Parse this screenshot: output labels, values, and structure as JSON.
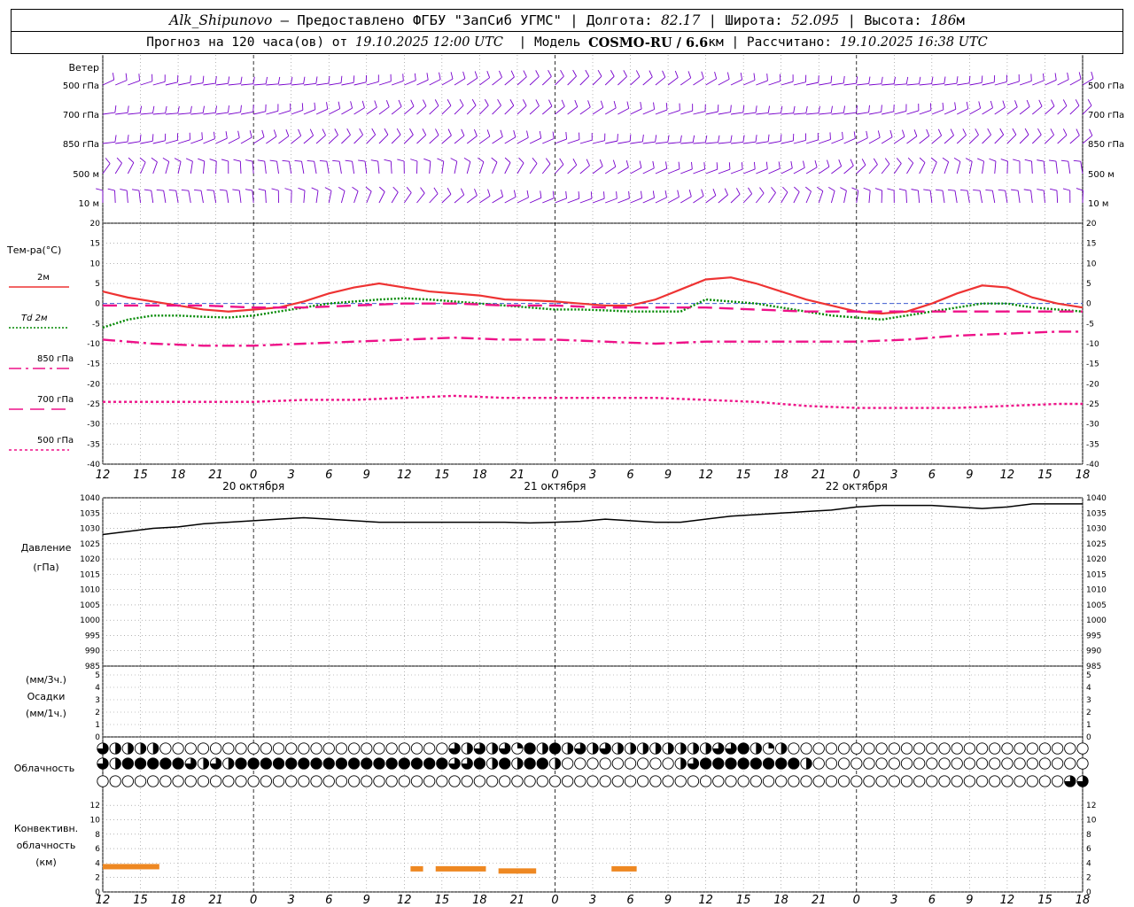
{
  "header": {
    "station": "Alk_Shipunovo",
    "provider": "Предоставлено ФГБУ \"ЗапСиб УГМС\"",
    "lon_label": "Долгота:",
    "lon": "82.17",
    "lat_label": "Широта:",
    "lat": "52.095",
    "alt_label": "Высота:",
    "alt": "186",
    "alt_unit": "м",
    "forecast_prefix": "Прогноз на 120 часа(ов) от",
    "forecast_start": "19.10.2025 12:00 UTC",
    "model_label": "Модель",
    "model": "COSMO-RU / 6.6",
    "model_unit": "км",
    "computed_label": "Рассчитано:",
    "computed": "19.10.2025 16:38 UTC"
  },
  "colors": {
    "wind": "#7700cc",
    "t2m": "#ee3333",
    "td2m": "#008800",
    "t850": "#ee1188",
    "t700": "#ee1188",
    "t500": "#ee1188",
    "pressure": "#000000",
    "convective": "#ee8822",
    "zero_line": "#2244cc",
    "grid": "#888888"
  },
  "chart_data": [
    {
      "type": "wind_barbs",
      "panel_label": "Ветер",
      "levels": [
        "500 гПа",
        "700 гПа",
        "850 гПа",
        "500 м",
        "10 м"
      ]
    },
    {
      "type": "line",
      "panel_label": "Тем-ра(°C)",
      "ylim": [
        -40,
        20
      ],
      "yticks": [
        -40,
        -35,
        -30,
        -25,
        -20,
        -15,
        -10,
        -5,
        0,
        5,
        10,
        15,
        20
      ],
      "xlim": [
        0,
        78
      ],
      "xticks": [
        "12",
        "15",
        "18",
        "21",
        "0",
        "3",
        "6",
        "9",
        "12",
        "15",
        "18",
        "21",
        "0",
        "3",
        "6",
        "9",
        "12",
        "15",
        "18",
        "21",
        "0",
        "3",
        "6",
        "9",
        "12",
        "15",
        "18"
      ],
      "day_labels": [
        "20 октября",
        "21 октября",
        "22 октября"
      ],
      "series": [
        {
          "name": "2м",
          "style": "solid",
          "color_key": "t2m",
          "x": [
            0,
            2,
            4,
            6,
            8,
            10,
            12,
            14,
            16,
            18,
            20,
            22,
            24,
            26,
            28,
            30,
            32,
            34,
            36,
            38,
            40,
            42,
            44,
            46,
            48,
            50,
            52,
            54,
            56,
            58,
            60,
            62,
            64,
            66,
            68,
            70,
            72,
            74,
            76,
            78
          ],
          "y": [
            3,
            1.5,
            0.5,
            -0.5,
            -1.5,
            -2,
            -1.5,
            -1,
            0.5,
            2.5,
            4,
            5,
            4,
            3,
            2.5,
            2,
            1,
            0.8,
            0.5,
            0,
            -0.5,
            -0.5,
            1,
            3.5,
            6,
            6.5,
            5,
            3,
            1,
            -0.5,
            -2,
            -2.5,
            -2,
            0,
            2.5,
            4.5,
            4,
            1.5,
            0,
            -1
          ]
        },
        {
          "name": "Td 2м",
          "style": "dotted",
          "color_key": "td2m",
          "x": [
            0,
            2,
            4,
            6,
            8,
            10,
            12,
            14,
            16,
            18,
            20,
            22,
            24,
            26,
            28,
            30,
            32,
            34,
            36,
            38,
            40,
            42,
            44,
            46,
            48,
            50,
            52,
            54,
            56,
            58,
            60,
            62,
            64,
            66,
            68,
            70,
            72,
            74,
            76,
            78
          ],
          "y": [
            -6,
            -4,
            -3,
            -3,
            -3.3,
            -3.5,
            -3,
            -2,
            -1,
            0,
            0.5,
            1,
            1.3,
            1,
            0.5,
            0,
            -0.5,
            -1,
            -1.5,
            -1.5,
            -1.7,
            -2,
            -2,
            -2,
            1,
            0.5,
            0,
            -1,
            -2,
            -3,
            -3.5,
            -4,
            -3,
            -2,
            -1,
            0,
            0,
            -1,
            -1.5,
            -2
          ]
        },
        {
          "name": "850 гПа",
          "style": "dashdot",
          "color_key": "t850",
          "x": [
            0,
            4,
            8,
            12,
            16,
            20,
            24,
            28,
            32,
            36,
            40,
            44,
            48,
            52,
            56,
            60,
            64,
            68,
            72,
            76,
            78
          ],
          "y": [
            -9,
            -10,
            -10.5,
            -10.5,
            -10,
            -9.5,
            -9,
            -8.5,
            -9,
            -9,
            -9.5,
            -10,
            -9.5,
            -9.5,
            -9.5,
            -9.5,
            -9,
            -8,
            -7.5,
            -7,
            -7
          ]
        },
        {
          "name": "700 гПа",
          "style": "longdash",
          "color_key": "t700",
          "x": [
            0,
            4,
            8,
            12,
            16,
            20,
            24,
            28,
            32,
            36,
            40,
            44,
            48,
            52,
            56,
            60,
            64,
            68,
            72,
            76,
            78
          ],
          "y": [
            -0.5,
            -0.5,
            -0.5,
            -1,
            -1,
            -0.5,
            0,
            0,
            -0.5,
            -0.5,
            -1,
            -1,
            -1,
            -1.5,
            -2,
            -2,
            -2,
            -2,
            -2,
            -2,
            -2
          ]
        },
        {
          "name": "500 гПа",
          "style": "dashed",
          "color_key": "t500",
          "x": [
            0,
            4,
            8,
            12,
            16,
            20,
            24,
            28,
            32,
            36,
            40,
            44,
            48,
            52,
            56,
            60,
            64,
            68,
            72,
            76,
            78
          ],
          "y": [
            -24.5,
            -24.5,
            -24.5,
            -24.5,
            -24,
            -24,
            -23.5,
            -23,
            -23.5,
            -23.5,
            -23.5,
            -23.5,
            -24,
            -24.5,
            -25.5,
            -26,
            -26,
            -26,
            -25.5,
            -25,
            -25
          ]
        }
      ]
    },
    {
      "type": "line",
      "panel_label": "Давление",
      "unit_label": "(гПа)",
      "ylim": [
        985,
        1040
      ],
      "yticks": [
        985,
        990,
        995,
        1000,
        1005,
        1010,
        1015,
        1020,
        1025,
        1030,
        1035,
        1040
      ],
      "series": [
        {
          "x": [
            0,
            2,
            4,
            6,
            8,
            10,
            12,
            14,
            16,
            18,
            20,
            22,
            24,
            26,
            28,
            30,
            32,
            34,
            36,
            38,
            40,
            42,
            44,
            46,
            48,
            50,
            52,
            54,
            56,
            58,
            60,
            62,
            64,
            66,
            68,
            70,
            72,
            74,
            76,
            78
          ],
          "y": [
            1028,
            1029,
            1030,
            1030.5,
            1031.5,
            1032,
            1032.5,
            1033,
            1033.5,
            1033,
            1032.5,
            1032,
            1032,
            1032,
            1032,
            1032,
            1032,
            1031.8,
            1032,
            1032.3,
            1033,
            1032.5,
            1032,
            1032,
            1033,
            1034,
            1034.5,
            1035,
            1035.5,
            1036,
            1037,
            1037.5,
            1037.5,
            1037.5,
            1037,
            1036.5,
            1037,
            1038,
            1038,
            1038
          ]
        }
      ]
    },
    {
      "type": "bar",
      "panel_label": "Осадки",
      "unit_labels": [
        "(мм/3ч.)",
        "(мм/1ч.)"
      ],
      "ylim": [
        0,
        5
      ],
      "yticks": [
        0,
        1,
        2,
        3,
        4,
        5
      ],
      "values": []
    },
    {
      "type": "cloud_symbols",
      "panel_label": "Облачность",
      "rows": [
        {
          "level": "upper",
          "x": [
            0,
            1,
            2,
            3,
            4,
            5,
            6,
            7,
            8,
            9,
            10,
            11,
            12,
            13,
            14,
            15,
            16,
            17,
            18,
            19,
            20,
            21,
            22,
            23,
            24,
            25,
            26,
            27,
            28,
            29,
            30,
            31,
            32,
            33,
            34,
            35,
            36,
            37,
            38,
            39,
            40,
            41,
            42,
            43,
            44,
            45,
            46,
            47,
            48,
            49,
            50,
            51,
            52,
            53,
            54,
            55,
            56,
            57,
            58,
            59,
            60,
            61,
            62,
            63,
            64,
            65,
            66,
            67,
            68,
            69,
            70,
            71,
            72,
            73,
            74,
            75,
            76,
            77,
            78
          ],
          "cover": [
            0.75,
            0.5,
            0.5,
            0.5,
            0.5,
            0,
            0,
            0,
            0,
            0,
            0,
            0,
            0,
            0,
            0,
            0,
            0,
            0,
            0,
            0,
            0,
            0,
            0,
            0,
            0,
            0,
            0,
            0,
            0.75,
            0.5,
            0.75,
            0.5,
            0.75,
            0.25,
            1,
            0.5,
            1,
            0.5,
            0.75,
            0.5,
            0.75,
            0.5,
            0.5,
            0.5,
            0.5,
            0.5,
            0.5,
            0.5,
            0.5,
            0.75,
            0.75,
            1,
            0.5,
            0.25,
            0.5,
            0,
            0,
            0,
            0,
            0,
            0,
            0,
            0,
            0,
            0,
            0,
            0,
            0,
            0,
            0,
            0,
            0,
            0,
            0,
            0,
            0,
            0,
            0,
            0
          ]
        },
        {
          "level": "middle",
          "x": [
            0,
            1,
            2,
            3,
            4,
            5,
            6,
            7,
            8,
            9,
            10,
            11,
            12,
            13,
            14,
            15,
            16,
            17,
            18,
            19,
            20,
            21,
            22,
            23,
            24,
            25,
            26,
            27,
            28,
            29,
            30,
            31,
            32,
            33,
            34,
            35,
            36,
            37,
            38,
            39,
            40,
            41,
            42,
            43,
            44,
            45,
            46,
            47,
            48,
            49,
            50,
            51,
            52,
            53,
            54,
            55,
            56,
            57,
            58,
            59,
            60,
            61,
            62,
            63,
            64,
            65,
            66,
            67,
            68,
            69,
            70,
            71,
            72,
            73,
            74,
            75,
            76,
            77,
            78
          ],
          "cover": [
            0.75,
            0.5,
            1,
            1,
            1,
            1,
            1,
            0.75,
            0.5,
            0.75,
            0.5,
            1,
            1,
            1,
            1,
            1,
            1,
            1,
            1,
            1,
            1,
            1,
            1,
            1,
            1,
            1,
            1,
            1,
            0.75,
            0.75,
            1,
            0.5,
            1,
            0.5,
            1,
            1,
            0.5,
            0,
            0,
            0,
            0,
            0,
            0,
            0,
            0,
            0,
            0.5,
            0.75,
            1,
            1,
            1,
            1,
            1,
            1,
            1,
            1,
            0.5,
            0,
            0,
            0,
            0,
            0,
            0,
            0,
            0,
            0,
            0,
            0,
            0,
            0,
            0,
            0,
            0,
            0,
            0,
            0,
            0,
            0,
            0
          ]
        },
        {
          "level": "lower",
          "x": [
            0,
            1,
            2,
            3,
            4,
            5,
            6,
            7,
            8,
            9,
            10,
            11,
            12,
            13,
            14,
            15,
            16,
            17,
            18,
            19,
            20,
            21,
            22,
            23,
            24,
            25,
            26,
            27,
            28,
            29,
            30,
            31,
            32,
            33,
            34,
            35,
            36,
            37,
            38,
            39,
            40,
            41,
            42,
            43,
            44,
            45,
            46,
            47,
            48,
            49,
            50,
            51,
            52,
            53,
            54,
            55,
            56,
            57,
            58,
            59,
            60,
            61,
            62,
            63,
            64,
            65,
            66,
            67,
            68,
            69,
            70,
            71,
            72,
            73,
            74,
            75,
            76,
            77,
            78
          ],
          "cover": [
            0,
            0,
            0,
            0,
            0,
            0,
            0,
            0,
            0,
            0,
            0,
            0,
            0,
            0,
            0,
            0,
            0,
            0,
            0,
            0,
            0,
            0,
            0,
            0,
            0,
            0,
            0,
            0,
            0,
            0,
            0,
            0,
            0,
            0,
            0,
            0,
            0,
            0,
            0,
            0,
            0,
            0,
            0,
            0,
            0,
            0,
            0,
            0,
            0,
            0,
            0,
            0,
            0,
            0,
            0,
            0,
            0,
            0,
            0,
            0,
            0,
            0,
            0,
            0,
            0,
            0,
            0,
            0,
            0,
            0,
            0,
            0,
            0,
            0,
            0,
            0,
            0,
            0.75,
            0.75
          ]
        }
      ]
    },
    {
      "type": "bar",
      "panel_label_lines": [
        "Конвективн.",
        "облачность",
        "(км)"
      ],
      "ylim": [
        0,
        13
      ],
      "yticks": [
        0,
        2,
        4,
        6,
        8,
        10,
        12
      ],
      "segments": [
        {
          "x0": 0,
          "x1": 4.5,
          "base": 3.5
        },
        {
          "x0": 24.5,
          "x1": 25.5,
          "base": 3.2
        },
        {
          "x0": 26.5,
          "x1": 30.5,
          "base": 3.2
        },
        {
          "x0": 31.5,
          "x1": 34.5,
          "base": 2.9
        },
        {
          "x0": 40.5,
          "x1": 42.5,
          "base": 3.2
        }
      ]
    }
  ]
}
